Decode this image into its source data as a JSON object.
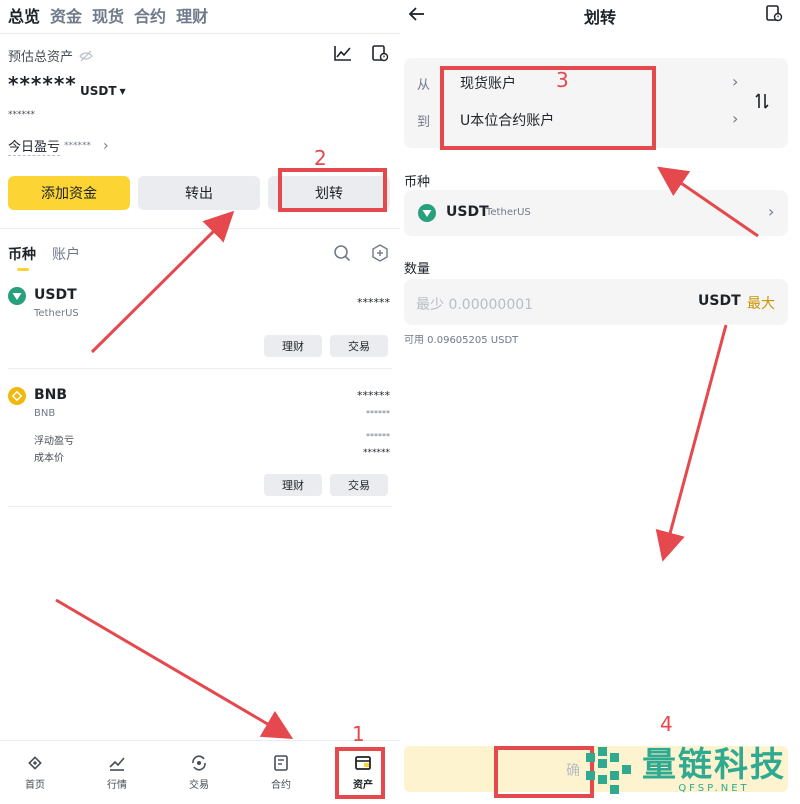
{
  "left": {
    "topnav": [
      "总览",
      "资金",
      "现货",
      "合约",
      "理财"
    ],
    "est_label": "预估总资产",
    "balance_masked": "******",
    "currency": "USDT",
    "sub_masked": "******",
    "pnl_label": "今日盈亏",
    "pnl_masked": "******",
    "btn_add": "添加资金",
    "btn_out": "转出",
    "btn_transfer": "划转",
    "tab_coin": "币种",
    "tab_account": "账户",
    "coins": [
      {
        "symbol": "USDT",
        "name": "TetherUS",
        "amount": "******",
        "btn1": "理财",
        "btn2": "交易"
      },
      {
        "symbol": "BNB",
        "name": "BNB",
        "amount": "******",
        "sub_amount": "******",
        "float_label": "浮动盈亏",
        "float_val": "******",
        "cost_label": "成本价",
        "cost_val": "******",
        "btn1": "理财",
        "btn2": "交易"
      }
    ],
    "bottom_nav": [
      "首页",
      "行情",
      "交易",
      "合约",
      "资产"
    ]
  },
  "right": {
    "title": "划转",
    "from_label": "从",
    "from_value": "现货账户",
    "to_label": "到",
    "to_value": "U本位合约账户",
    "coin_label": "币种",
    "coin_symbol": "USDT",
    "coin_name": "TetherUS",
    "amount_label": "数量",
    "amount_placeholder": "最少 0.00000001",
    "amount_unit": "USDT",
    "max_label": "最大",
    "available": "可用 0.09605205 USDT",
    "confirm_partial": "确"
  },
  "annotations": [
    "1",
    "2",
    "3",
    "4"
  ],
  "watermark": {
    "cn": "量链科技",
    "en": "QFSP.NET"
  },
  "colors": {
    "accent": "#fcd535",
    "annotation": "#e5484d",
    "max": "#c99400",
    "teal": "#26a17b"
  }
}
